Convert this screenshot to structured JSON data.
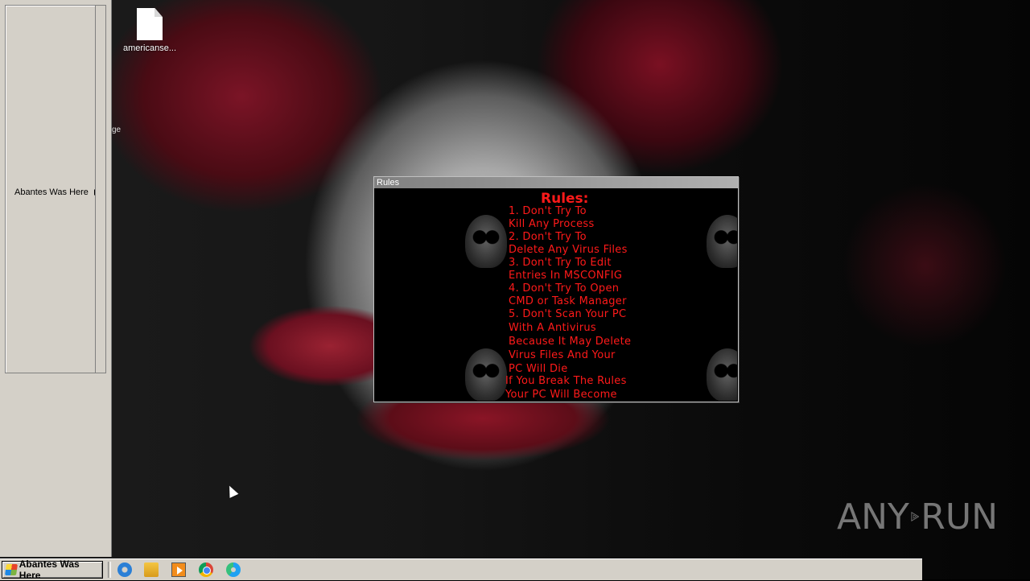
{
  "desktop": {
    "icons": [
      {
        "label": "americanse..."
      }
    ],
    "fragments": [
      "ge"
    ]
  },
  "left_menu": {
    "item_label": "Abantes Was Here"
  },
  "rules_window": {
    "title": "Rules",
    "heading": "Rules:",
    "lines": [
      "1. Don't Try To",
      "Kill Any Process",
      "2. Don't Try To",
      "Delete Any Virus Files",
      "3. Don't Try To Edit",
      "Entries In MSCONFIG",
      "4. Don't Try To Open",
      "CMD or Task Manager",
      "5. Don't Scan Your PC",
      "With A Antivirus",
      "Because It May Delete",
      "Virus Files And Your",
      "PC Will Die",
      "If You Break The Rules",
      "Your PC Will Become"
    ],
    "text_color": "#ff1a1a"
  },
  "taskbar": {
    "start_label": "Abantes Was Here",
    "quick_launch": [
      "internet-explorer-icon",
      "folder-icon",
      "media-player-icon",
      "chrome-icon",
      "edge-icon"
    ]
  },
  "watermark": {
    "left": "ANY",
    "right": "RUN"
  }
}
